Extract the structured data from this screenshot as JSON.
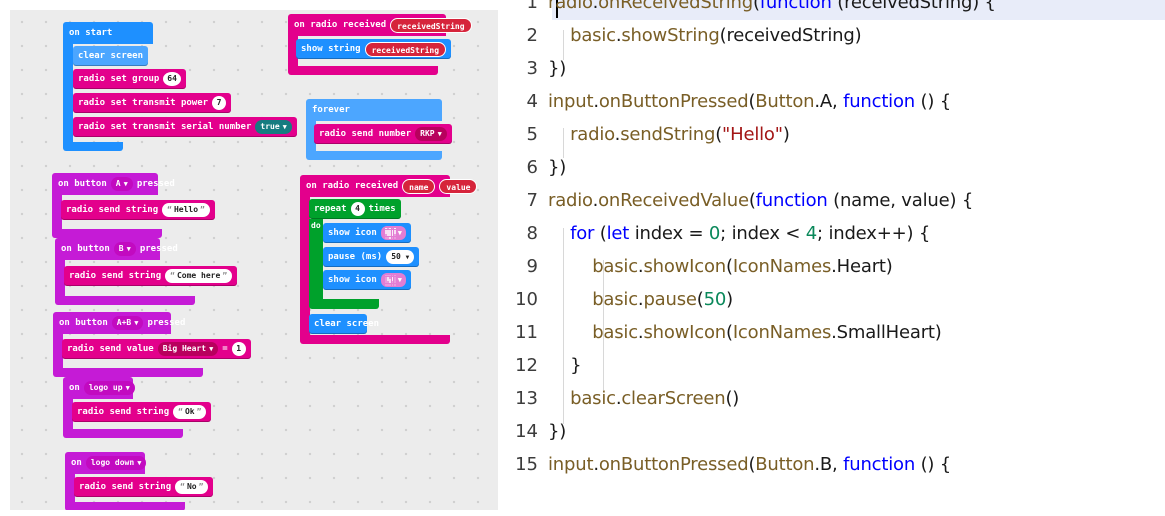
{
  "blocks": {
    "on_start": "on start",
    "clear_screen": "clear screen",
    "radio_set_group": "radio set group",
    "group_value": "64",
    "radio_set_transmit_power": "radio set transmit power",
    "power_value": "7",
    "radio_set_transmit_serial_number": "radio set transmit serial number",
    "serial_value": "true",
    "on_radio_received": "on radio received",
    "received_string_var": "receivedString",
    "show_string": "show string",
    "forever": "forever",
    "radio_send_number": "radio send number",
    "rkp_value": "RKP",
    "name_var": "name",
    "value_var": "value",
    "repeat": "repeat",
    "repeat_count": "4",
    "times": "times",
    "do": "do",
    "show_icon": "show icon",
    "pause_ms": "pause (ms)",
    "pause_value": "50",
    "on_button": "on button",
    "pressed": "pressed",
    "button_a": "A",
    "button_b": "B",
    "button_ab": "A+B",
    "radio_send_string": "radio send string",
    "hello_str": "Hello",
    "come_here_str": "Come here",
    "radio_send_value": "radio send value",
    "big_heart": "Big Heart",
    "equals": "=",
    "send_value_number": "1",
    "on": "on",
    "logo_up": "logo up",
    "ok_str": "Ok",
    "logo_down": "logo down",
    "no_str": "No"
  },
  "editor": {
    "lines": [
      {
        "n": "1",
        "text": "radio.onReceivedString(function (receivedString) {"
      },
      {
        "n": "2",
        "text": "    basic.showString(receivedString)"
      },
      {
        "n": "3",
        "text": "})"
      },
      {
        "n": "4",
        "text": "input.onButtonPressed(Button.A, function () {"
      },
      {
        "n": "5",
        "text": "    radio.sendString(\"Hello\")"
      },
      {
        "n": "6",
        "text": "})"
      },
      {
        "n": "7",
        "text": "radio.onReceivedValue(function (name, value) {"
      },
      {
        "n": "8",
        "text": "    for (let index = 0; index < 4; index++) {"
      },
      {
        "n": "9",
        "text": "        basic.showIcon(IconNames.Heart)"
      },
      {
        "n": "10",
        "text": "        basic.pause(50)"
      },
      {
        "n": "11",
        "text": "        basic.showIcon(IconNames.SmallHeart)"
      },
      {
        "n": "12",
        "text": "    }"
      },
      {
        "n": "13",
        "text": "    basic.clearScreen()"
      },
      {
        "n": "14",
        "text": "})"
      },
      {
        "n": "15",
        "text": "input.onButtonPressed(Button.B, function () {"
      }
    ]
  },
  "colors": {
    "basic": "#1e90ff",
    "radio": "#e3008c",
    "input": "#c51bd6",
    "loops": "#00a12b",
    "keyword": "#0000ff",
    "number": "#09885a",
    "string": "#a31515",
    "function": "#795e26"
  }
}
